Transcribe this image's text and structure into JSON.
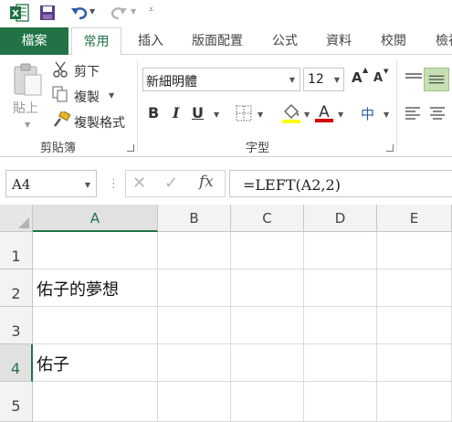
{
  "quick_access": {
    "icons": [
      "excel-logo",
      "save-icon",
      "undo-icon",
      "redo-icon",
      "customize-icon"
    ]
  },
  "tabs": {
    "file": "檔案",
    "home": "常用",
    "insert": "插入",
    "page_layout": "版面配置",
    "formulas": "公式",
    "data": "資料",
    "review": "校閱",
    "view": "檢視"
  },
  "clipboard": {
    "paste": "貼上",
    "cut": "剪下",
    "copy": "複製",
    "format_painter": "複製格式",
    "group_label": "剪貼簿"
  },
  "font": {
    "name": "新細明體",
    "size": "12",
    "bold": "B",
    "italic": "I",
    "underline": "U",
    "grow": "A",
    "shrink": "A",
    "font_color_glyph": "A",
    "phonetic": "中",
    "group_label": "字型",
    "font_color": "#d00000",
    "fill_color": "#ffff00"
  },
  "formula_bar": {
    "name_box": "A4",
    "formula": "=LEFT(A2,2)",
    "fx": "fx"
  },
  "sheet": {
    "columns": [
      "A",
      "B",
      "C",
      "D",
      "E"
    ],
    "rows": [
      "1",
      "2",
      "3",
      "4",
      "5"
    ],
    "selected_cell": "A4",
    "cells": {
      "A2": "佑子的夢想",
      "A4": "佑子"
    }
  },
  "colors": {
    "accent": "#217346",
    "selection_fill": "#e1e1e1"
  }
}
